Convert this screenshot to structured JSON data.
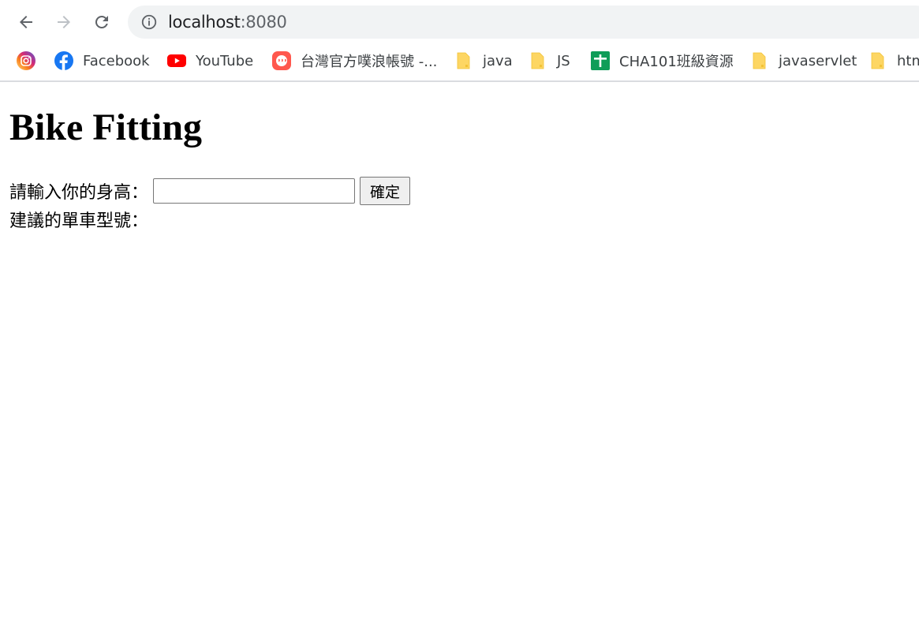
{
  "browser": {
    "url_host": "localhost",
    "url_port": ":8080",
    "bookmarks": [
      {
        "label": "",
        "icon": "instagram-icon"
      },
      {
        "label": "Facebook",
        "icon": "facebook-icon"
      },
      {
        "label": "YouTube",
        "icon": "youtube-icon"
      },
      {
        "label": "台灣官方噗浪帳號 -...",
        "icon": "plurk-icon"
      },
      {
        "label": "java",
        "icon": "folder-icon"
      },
      {
        "label": "JS",
        "icon": "folder-icon"
      },
      {
        "label": "CHA101班級資源",
        "icon": "google-sheets-icon"
      },
      {
        "label": "javaservlet",
        "icon": "folder-icon"
      },
      {
        "label": "htm",
        "icon": "folder-icon"
      }
    ]
  },
  "page": {
    "title": "Bike Fitting",
    "height_label": "請輸入你的身高：",
    "height_value": "",
    "confirm_label": "確定",
    "result_label": "建議的單車型號："
  },
  "colors": {
    "folder": "#fdd663",
    "youtube": "#ff0000",
    "facebook": "#1877f2",
    "plurk": "#ff574d",
    "sheets": "#0f9d58"
  }
}
